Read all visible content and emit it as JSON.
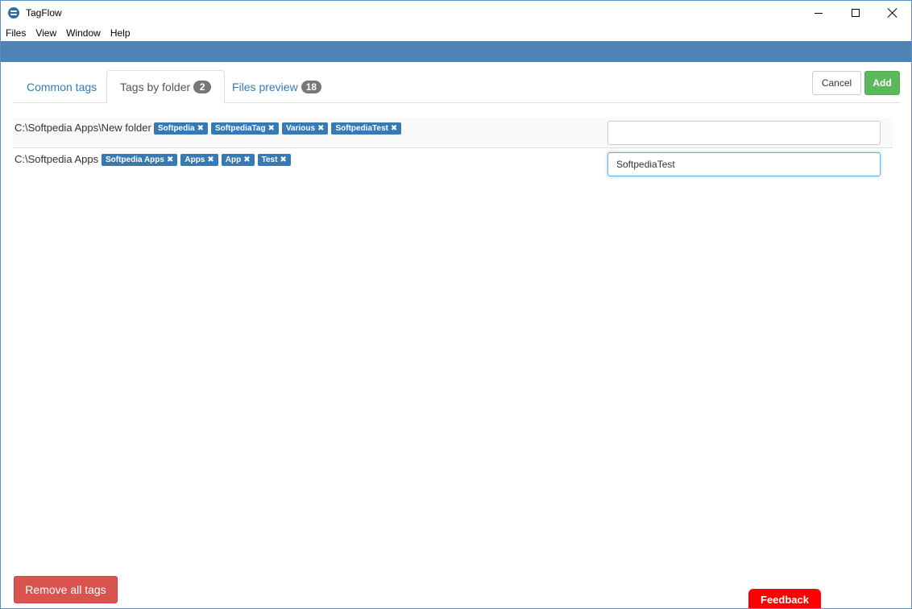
{
  "window": {
    "title": "TagFlow"
  },
  "menu": [
    "Files",
    "View",
    "Window",
    "Help"
  ],
  "tabs": [
    {
      "label": "Common tags",
      "count": null
    },
    {
      "label": "Tags by folder",
      "count": "2"
    },
    {
      "label": "Files preview",
      "count": "18"
    }
  ],
  "actions": {
    "cancel": "Cancel",
    "add": "Add"
  },
  "folders": [
    {
      "path": "C:\\Softpedia Apps\\New folder",
      "tags": [
        "Softpedia",
        "SoftpediaTag",
        "Various",
        "SoftpediaTest"
      ],
      "input_value": ""
    },
    {
      "path": "C:\\Softpedia Apps",
      "tags": [
        "Softpedia Apps",
        "Apps",
        "App",
        "Test"
      ],
      "input_value": "SoftpediaTest"
    }
  ],
  "footer": {
    "remove_all": "Remove all tags",
    "feedback": "Feedback"
  },
  "colors": {
    "accent": "#5083b5",
    "tag": "#337ab7",
    "add": "#5cb85c",
    "danger": "#d9534f",
    "feedback": "#ff0000"
  }
}
